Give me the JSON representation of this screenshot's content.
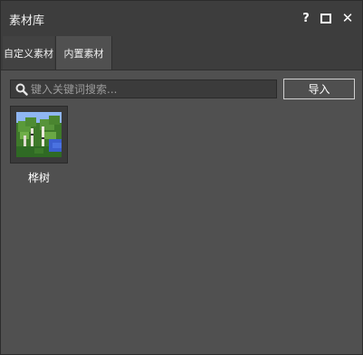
{
  "window": {
    "title": "素材库",
    "help_icon": "question-icon",
    "maximize_icon": "maximize-icon",
    "close_icon": "close-icon"
  },
  "tabs": [
    {
      "label": "自定义素材",
      "active": false
    },
    {
      "label": "内置素材",
      "active": true
    }
  ],
  "search": {
    "icon": "search-icon",
    "placeholder": "键入关键词搜索...",
    "value": ""
  },
  "import_button": {
    "label": "导入"
  },
  "assets": [
    {
      "label": "桦树",
      "thumbnail": "birch-forest-thumbnail"
    }
  ],
  "colors": {
    "window_bg": "#505050",
    "titlebar_bg": "#3d3d3d",
    "text": "#ffffff"
  }
}
